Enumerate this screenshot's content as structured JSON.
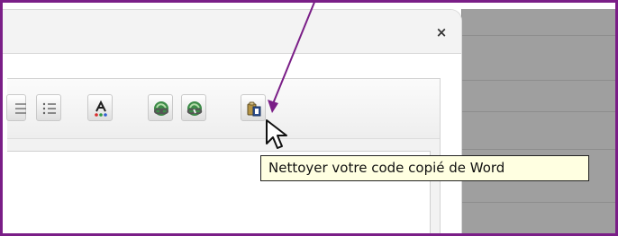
{
  "dialog": {
    "close_label": "×"
  },
  "toolbar": {
    "buttons": [
      {
        "name": "bullet-list-partial",
        "icon": "list-icon"
      },
      {
        "name": "bullet-list",
        "icon": "list-icon"
      },
      {
        "name": "text-color",
        "icon": "text-color-icon"
      },
      {
        "name": "insert-link",
        "icon": "link-icon"
      },
      {
        "name": "remove-link",
        "icon": "unlink-icon"
      },
      {
        "name": "paste-from-word",
        "icon": "paste-word-icon"
      }
    ]
  },
  "tooltip": {
    "text": "Nettoyer votre code copié de Word"
  },
  "colors": {
    "annotation": "#7a1e87",
    "tooltip_background": "#ffffe1",
    "toolbar_background": "#f2f2f2"
  }
}
